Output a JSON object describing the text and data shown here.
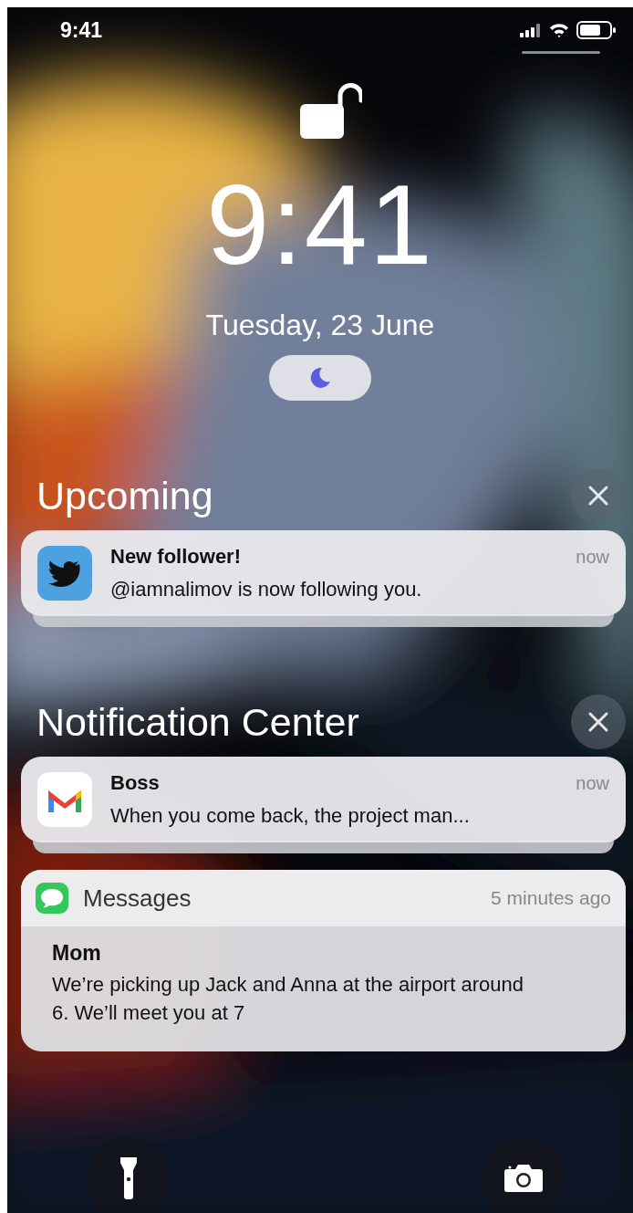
{
  "status_bar": {
    "time": "9:41"
  },
  "lock_screen": {
    "time": "9:41",
    "date": "Tuesday, 23 June"
  },
  "sections": [
    {
      "title": "Upcoming",
      "notifications": [
        {
          "kind": "compact",
          "stacked": true,
          "title": "New follower!",
          "time": "now",
          "body": "@iamnalimov is now following you."
        }
      ]
    },
    {
      "title": "Notification Center",
      "notifications": [
        {
          "kind": "compact",
          "stacked": true,
          "title": "Boss",
          "time": "now",
          "body": "When you come back, the project man..."
        },
        {
          "kind": "expanded",
          "app": "Messages",
          "time": "5 minutes ago",
          "title": "Mom",
          "body": "We’re picking up Jack and Anna at the airport around 6. We’ll meet you at 7"
        }
      ]
    }
  ]
}
